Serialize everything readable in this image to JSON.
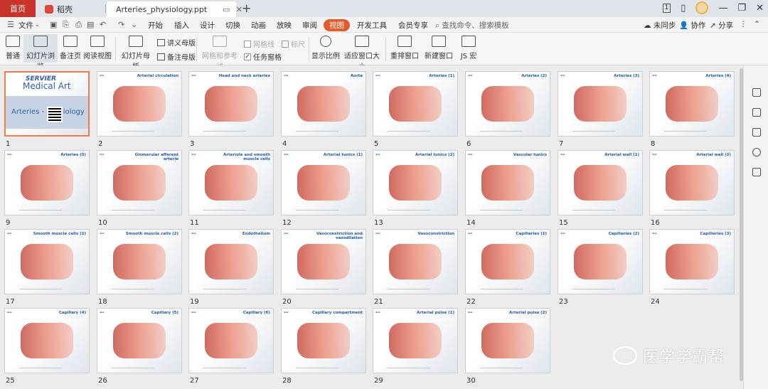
{
  "tabs": {
    "home": "首页",
    "daoke": "稻壳",
    "document": "Arteries_physiology.ppt"
  },
  "menu": {
    "file": "文件",
    "items": [
      "开始",
      "插入",
      "设计",
      "切换",
      "动画",
      "放映",
      "审阅",
      "视图",
      "开发工具",
      "会员专享"
    ],
    "active": "视图",
    "search": "查找命令、搜索模板",
    "unsync": "未同步",
    "collab": "协作",
    "share": "分享"
  },
  "ribbon": {
    "normal": "普通",
    "slide_sorter": "幻灯片浏览",
    "notes_page": "备注页",
    "reading_view": "阅读视图",
    "slide_master": "幻灯片母版",
    "handout_master": "讲义母版",
    "notes_master": "备注母版",
    "gridlines": "网格线",
    "ruler": "标尺",
    "grid_guides": "网格和参考线",
    "task_pane": "任务窗格",
    "zoom": "显示比例",
    "fit_window": "适应窗口大小",
    "arrange_window": "重排窗口",
    "new_window": "新建窗口",
    "macro": "JS 宏"
  },
  "slides": [
    {
      "num": "1",
      "title": "Arteries - Physiology"
    },
    {
      "num": "2",
      "title": "Arterial circulation"
    },
    {
      "num": "3",
      "title": "Head and neck arteries"
    },
    {
      "num": "4",
      "title": "Aorta"
    },
    {
      "num": "5",
      "title": "Arteries (1)"
    },
    {
      "num": "6",
      "title": "Arteries (2)"
    },
    {
      "num": "7",
      "title": "Arteries (3)"
    },
    {
      "num": "8",
      "title": "Arteries (4)"
    },
    {
      "num": "9",
      "title": "Arteries (5)"
    },
    {
      "num": "10",
      "title": "Glomerular afferent arterie"
    },
    {
      "num": "11",
      "title": "Arteriole and smooth muscle cells"
    },
    {
      "num": "12",
      "title": "Arterial tunics (1)"
    },
    {
      "num": "13",
      "title": "Arterial tunics (2)"
    },
    {
      "num": "14",
      "title": "Vascular tunics"
    },
    {
      "num": "15",
      "title": "Arterial wall (1)"
    },
    {
      "num": "16",
      "title": "Arterial wall (2)"
    },
    {
      "num": "17",
      "title": "Smooth muscle cells (1)"
    },
    {
      "num": "18",
      "title": "Smooth muscle cells (2)"
    },
    {
      "num": "19",
      "title": "Endothelium"
    },
    {
      "num": "20",
      "title": "Vasoconstriction and vasodilation"
    },
    {
      "num": "21",
      "title": "Vasoconstriction"
    },
    {
      "num": "22",
      "title": "Capillaries (1)"
    },
    {
      "num": "23",
      "title": "Capillaries (2)"
    },
    {
      "num": "24",
      "title": "Capillaries (3)"
    },
    {
      "num": "25",
      "title": "Capillary (4)"
    },
    {
      "num": "26",
      "title": "Capillary (5)"
    },
    {
      "num": "27",
      "title": "Capillary (6)"
    },
    {
      "num": "28",
      "title": "Capillary compartment"
    },
    {
      "num": "29",
      "title": "Arterial pulse (1)"
    },
    {
      "num": "30",
      "title": "Arterial pulse (2)"
    }
  ],
  "title_slide": {
    "line1": "SERVIER",
    "line2": "Medical Art",
    "main": "Arteries - Physiology"
  },
  "watermark": "医学学霸帮",
  "colors": {
    "accent": "#e45b2b",
    "home_tab": "#c8342b",
    "selected_border": "#f07b4e",
    "slide_title": "#1e5aa8"
  }
}
